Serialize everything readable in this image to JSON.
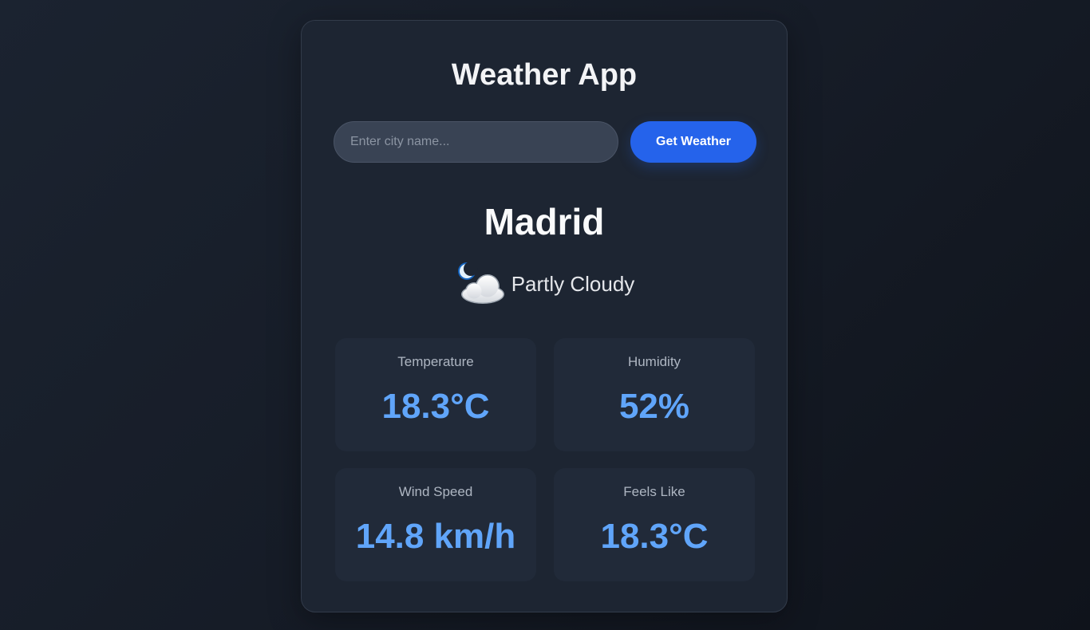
{
  "app": {
    "title": "Weather App"
  },
  "search": {
    "placeholder": "Enter city name...",
    "value": "",
    "button_label": "Get Weather"
  },
  "weather": {
    "city": "Madrid",
    "condition": "Partly Cloudy",
    "icon": "moon-cloud-icon"
  },
  "stats": [
    {
      "label": "Temperature",
      "value": "18.3°C"
    },
    {
      "label": "Humidity",
      "value": "52%"
    },
    {
      "label": "Wind Speed",
      "value": "14.8 km/h"
    },
    {
      "label": "Feels Like",
      "value": "18.3°C"
    }
  ],
  "colors": {
    "accent": "#2563eb",
    "value_blue": "#60a5fa",
    "card_bg": "#1d2532",
    "page_bg": "#161c27"
  }
}
